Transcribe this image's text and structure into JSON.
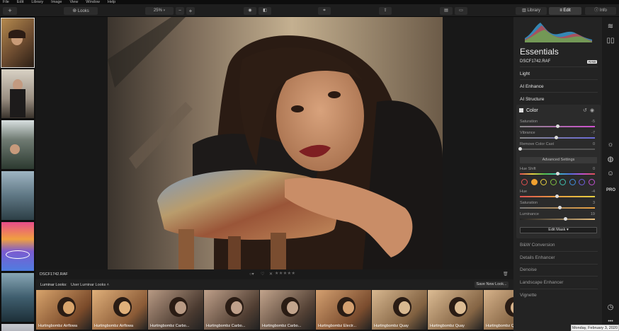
{
  "menu": [
    "File",
    "Edit",
    "Library",
    "Image",
    "View",
    "Window",
    "Help"
  ],
  "toolbar": {
    "add_label": "+",
    "looks_label": "Looks",
    "zoom_value": "25%",
    "zoom_minus": "–",
    "zoom_plus": "+",
    "tab_library": "Library",
    "tab_edit": "Edit",
    "tab_info": "Info"
  },
  "image_bar": {
    "filename": "DSCF1742.RAF",
    "stars": "★★★★★"
  },
  "looks_bar": {
    "label": "Luminar Looks:",
    "selected": "User Luminar Looks",
    "save_button": "Save New Look..."
  },
  "looks": [
    "Hurtingbombz Airflowa",
    "Hurtingbombz Airflowa",
    "Hurtingbombz Carbo...",
    "Hurtingbombz Carbo...",
    "Hurtingbombz Carbo...",
    "Hurtingbombz Electr...",
    "Hurtingbombz Quay",
    "Hurtingbombz Quay",
    "Hurtingbombz Quay"
  ],
  "panel": {
    "title": "Essentials",
    "filename": "DSCF1742.RAF",
    "raw_badge": "RAW",
    "sections_top": [
      "Light",
      "AI Enhance",
      "AI Structure"
    ],
    "color": {
      "title": "Color",
      "saturation_label": "Saturation",
      "saturation_value": "-5",
      "vibrance_label": "Vibrance",
      "vibrance_value": "-7",
      "remove_cast_label": "Remove Color Cast",
      "remove_cast_value": "0",
      "advanced": "Advanced Settings",
      "hue_shift_label": "Hue Shift",
      "hue_shift_value": "0",
      "hue_label": "Hue",
      "hue_value": "-4",
      "sat2_label": "Saturation",
      "sat2_value": "3",
      "lum_label": "Luminance",
      "lum_value": "19",
      "edit_mask": "Edit Mask ▾"
    },
    "sections_bottom": [
      "B&W Conversion",
      "Details Enhancer",
      "Denoise",
      "Landscape Enhancer",
      "Vignette"
    ]
  },
  "colors": {
    "dots": [
      "#e05050",
      "#f0a030",
      "#e8d040",
      "#80c040",
      "#40c0b0",
      "#4090e0",
      "#7060e0",
      "#c050d0"
    ]
  },
  "rail": {
    "pro_label": "PRO"
  },
  "date_badge": "Monday, February 3, 2020"
}
